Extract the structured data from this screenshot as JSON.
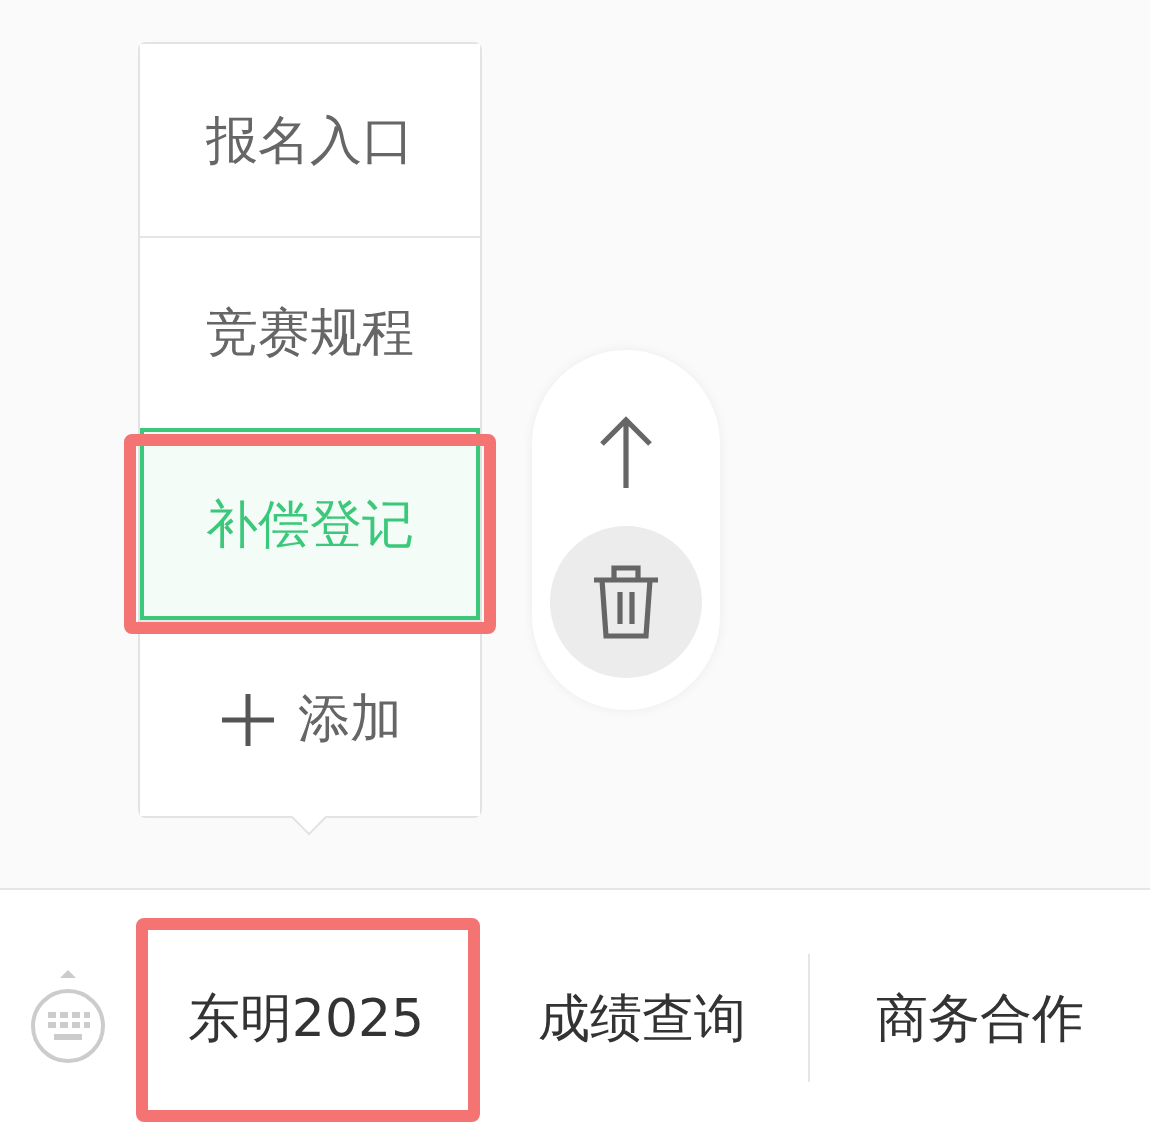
{
  "submenu": {
    "items": [
      {
        "label": "报名入口",
        "selected": false,
        "highlighted": false
      },
      {
        "label": "竞赛规程",
        "selected": false,
        "highlighted": false
      },
      {
        "label": "补偿登记",
        "selected": true,
        "highlighted": true
      }
    ],
    "add_label": "添加"
  },
  "menu_bar": {
    "items": [
      {
        "label": "东明2025",
        "highlighted": true
      },
      {
        "label": "成绩查询",
        "highlighted": false
      },
      {
        "label": "商务合作",
        "highlighted": false
      }
    ]
  }
}
